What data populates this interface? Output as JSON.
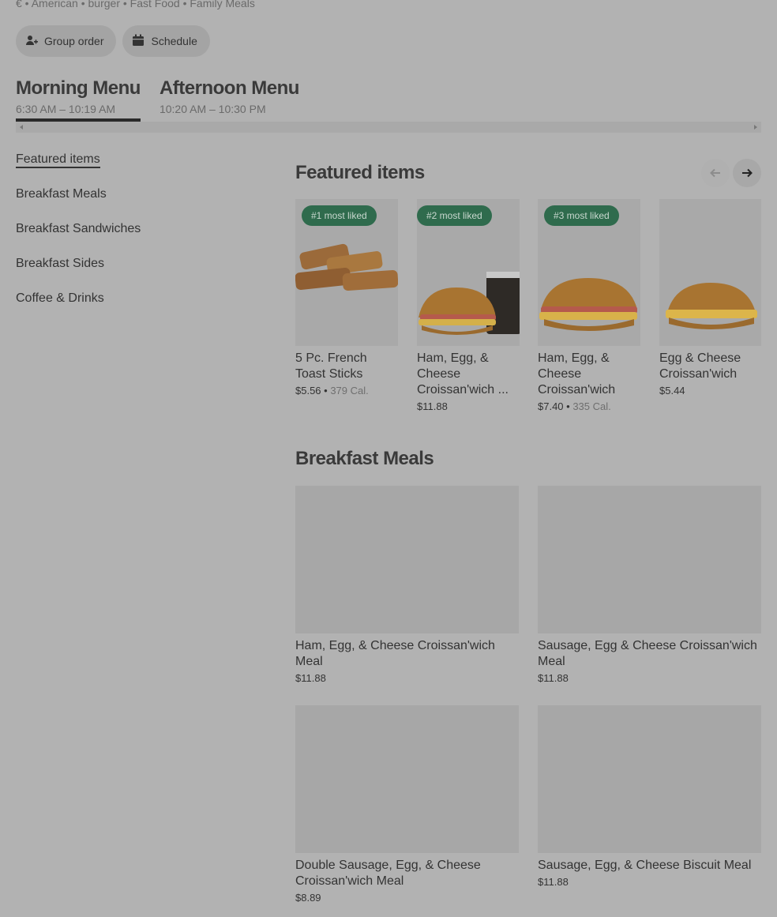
{
  "restaurant": {
    "tags": "€ • American • burger • Fast Food • Family Meals"
  },
  "actions": {
    "group_order": "Group order",
    "schedule": "Schedule"
  },
  "menus": [
    {
      "title": "Morning Menu",
      "hours": "6:30 AM – 10:19 AM"
    },
    {
      "title": "Afternoon Menu",
      "hours": "10:20 AM – 10:30 PM"
    }
  ],
  "sidebar": {
    "items": [
      {
        "label": "Featured items"
      },
      {
        "label": "Breakfast Meals"
      },
      {
        "label": "Breakfast Sandwiches"
      },
      {
        "label": "Breakfast Sides"
      },
      {
        "label": "Coffee & Drinks"
      }
    ]
  },
  "featured": {
    "title": "Featured items",
    "items": [
      {
        "badge": "#1 most liked",
        "name": "5 Pc. French Toast Sticks",
        "price": "$5.56",
        "calories": "379 Cal."
      },
      {
        "badge": "#2 most liked",
        "name": "Ham, Egg, & Cheese Croissan'wich ...",
        "price": "$11.88",
        "calories": ""
      },
      {
        "badge": "#3 most liked",
        "name": "Ham, Egg, & Cheese Croissan'wich",
        "price": "$7.40",
        "calories": "335 Cal."
      },
      {
        "badge": "",
        "name": "Egg & Cheese Croissan'wich",
        "price": "$5.44",
        "calories": ""
      }
    ]
  },
  "breakfast_meals": {
    "title": "Breakfast Meals",
    "items": [
      {
        "name": "Ham, Egg, & Cheese Croissan'wich Meal",
        "price": "$11.88"
      },
      {
        "name": "Sausage, Egg & Cheese Croissan'wich Meal",
        "price": "$11.88"
      },
      {
        "name": "Double Sausage, Egg, & Cheese Croissan'wich Meal",
        "price": "$8.89"
      },
      {
        "name": "Sausage, Egg, & Cheese Biscuit Meal",
        "price": "$11.88"
      }
    ]
  },
  "colors": {
    "badge_bg": "#2f6b4d",
    "overlay_bg": "#b2b2b2"
  }
}
